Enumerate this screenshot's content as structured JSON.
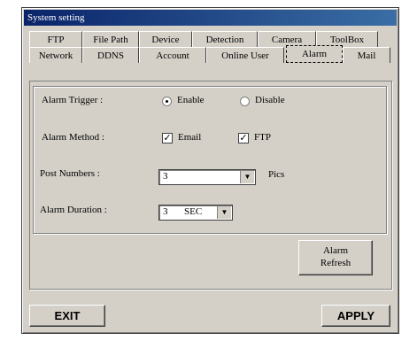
{
  "window": {
    "title": "System setting"
  },
  "tabs": {
    "row1": [
      "FTP",
      "File Path",
      "Device",
      "Detection",
      "Camera",
      "ToolBox"
    ],
    "row2": [
      "Network",
      "DDNS",
      "Account",
      "Online User",
      "Alarm",
      "Mail"
    ],
    "active": "Alarm"
  },
  "alarm": {
    "trigger": {
      "label": "Alarm Trigger :",
      "options": [
        "Enable",
        "Disable"
      ],
      "selected": "Enable"
    },
    "method": {
      "label": "Alarm Method :",
      "email": "Email",
      "email_checked": true,
      "ftp": "FTP",
      "ftp_checked": true
    },
    "post_numbers": {
      "label": "Post Numbers :",
      "value": "3",
      "unit": "Pics"
    },
    "duration": {
      "label": "Alarm Duration :",
      "value": "3",
      "unit": "SEC"
    },
    "refresh_line1": "Alarm",
    "refresh_line2": "Refresh"
  },
  "buttons": {
    "exit": "EXIT",
    "apply": "APPLY"
  },
  "icons": {
    "dropdown": "chevron-down-icon",
    "check": "checkmark-icon"
  }
}
